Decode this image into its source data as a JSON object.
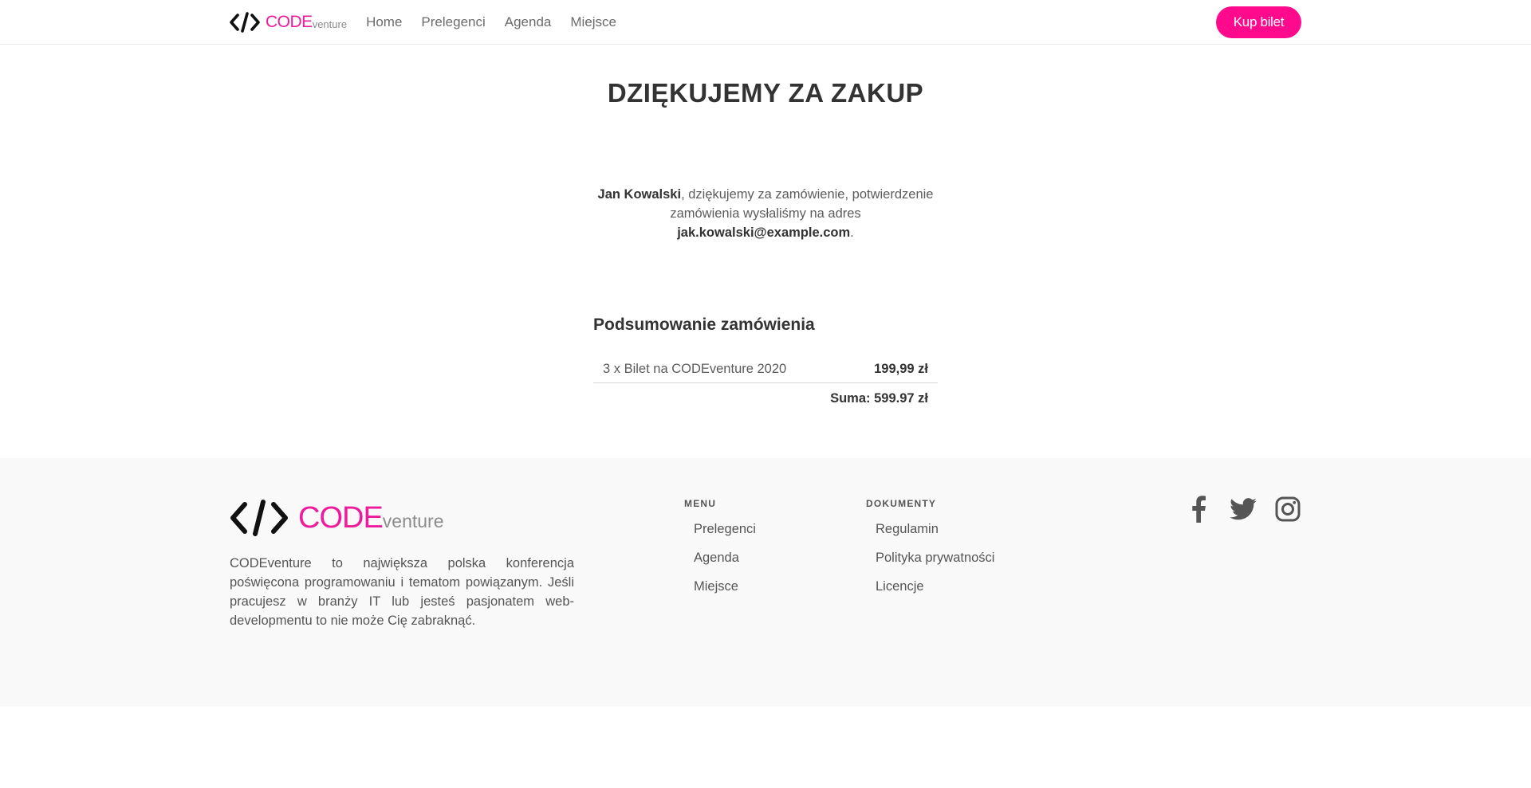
{
  "brand": {
    "code": "CODE",
    "venture": "venture"
  },
  "nav": {
    "links": [
      "Home",
      "Prelegenci",
      "Agenda",
      "Miejsce"
    ],
    "buy_label": "Kup bilet"
  },
  "main": {
    "title": "DZIĘKUJEMY ZA ZAKUP",
    "customer_name": "Jan Kowalski",
    "thanks_text": ", dziękujemy za zamówienie, potwierdzenie zamówienia wysłaliśmy na adres ",
    "email": "jak.kowalski@example.com",
    "period": "."
  },
  "summary": {
    "title": "Podsumowanie zamówienia",
    "item": "3 x Bilet na CODEventure 2020",
    "price": "199,99 zł",
    "total": "Suma: 599.97 zł"
  },
  "footer": {
    "description": "CODEventure to największa polska konferencja poświęcona programowaniu i tematom powiązanym. Jeśli pracujesz w branży IT lub jesteś pasjonatem web-developmentu to nie może Cię zabraknąć.",
    "menu_title": "MENU",
    "menu_links": [
      "Prelegenci",
      "Agenda",
      "Miejsce"
    ],
    "docs_title": "DOKUMENTY",
    "docs_links": [
      "Regulamin",
      "Polityka prywatności",
      "Licencje"
    ],
    "social": [
      "facebook-icon",
      "twitter-icon",
      "instagram-icon"
    ]
  },
  "colors": {
    "accent": "#ff0a8c",
    "brand_pink": "#ee1c9c",
    "footer_bg": "#f9f9f9"
  }
}
